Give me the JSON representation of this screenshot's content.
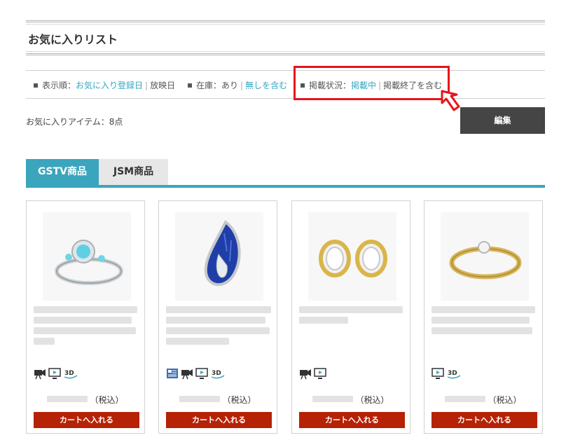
{
  "page": {
    "title": "お気に入りリスト"
  },
  "filters": {
    "sort": {
      "label": "表示順：",
      "options": [
        "お気に入り登録日",
        "放映日"
      ]
    },
    "stock": {
      "label": "在庫：",
      "options": [
        "あり",
        "無しを含む"
      ]
    },
    "status": {
      "label": "掲載状況：",
      "options": [
        "掲載中",
        "掲載終了を含む"
      ]
    }
  },
  "favorites_count": "お気に入りアイテム：8点",
  "edit_label": "編集",
  "tabs": [
    {
      "label": "GSTV商品",
      "active": true
    },
    {
      "label": "JSM商品",
      "active": false
    }
  ],
  "products": [
    {
      "image": "aquamarine-ring",
      "icons": [
        "video-icon",
        "tv-play-icon",
        "3d-icon"
      ],
      "price_suffix": "（税込）",
      "cart_label": "カートへ入れる"
    },
    {
      "image": "sapphire-pendant",
      "icons": [
        "catalog-icon",
        "video-icon",
        "tv-play-icon",
        "3d-icon"
      ],
      "price_suffix": "（税込）",
      "cart_label": "カートへ入れる"
    },
    {
      "image": "hoop-earrings",
      "icons": [
        "video-icon",
        "tv-play-icon"
      ],
      "price_suffix": "（税込）",
      "cart_label": "カートへ入れる"
    },
    {
      "image": "diamond-gold-ring",
      "icons": [
        "tv-play-icon",
        "3d-icon"
      ],
      "price_suffix": "（税込）",
      "cart_label": "カートへ入れる"
    }
  ],
  "colors": {
    "accent": "#3aa5bd",
    "link": "#34a6c1",
    "cart_button": "#b52205",
    "highlight": "#e8141b",
    "edit_button": "#454545"
  }
}
